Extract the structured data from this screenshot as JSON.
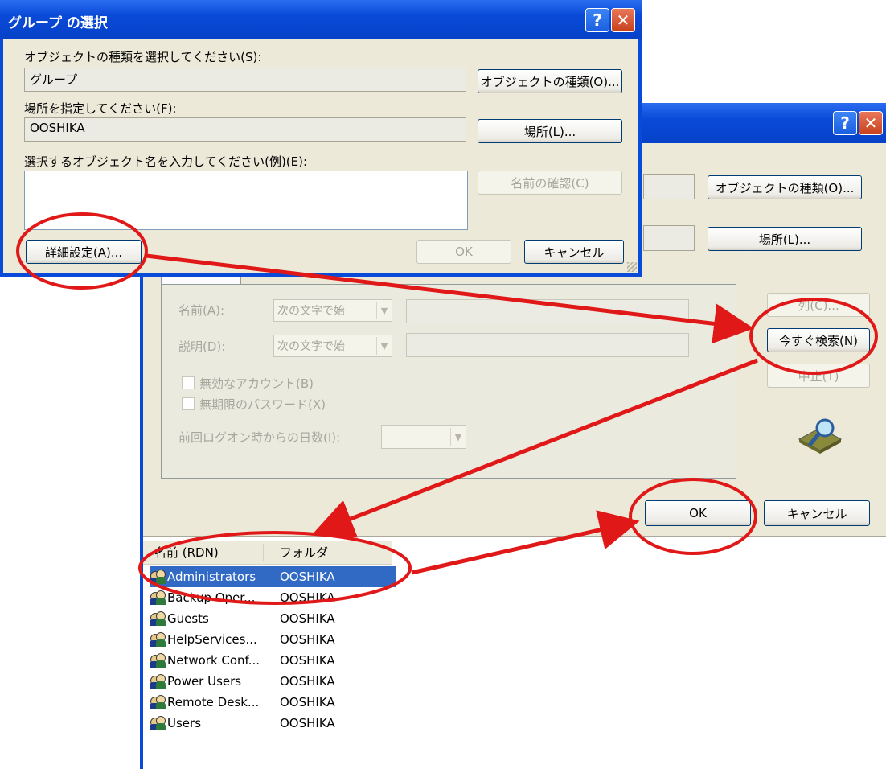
{
  "front_dialog": {
    "title": "グループ の選択",
    "help_glyph": "?",
    "close_glyph": "✕",
    "object_type_label": "オブジェクトの種類を選択してください(S):",
    "object_type_value": "グループ",
    "object_type_button": "オブジェクトの種類(O)...",
    "location_label": "場所を指定してください(F):",
    "location_value": "OOSHIKA",
    "location_button": "場所(L)...",
    "enter_names_label": "選択するオブジェクト名を入力してください(例)(E):",
    "check_names_button": "名前の確認(C)",
    "advanced_button": "詳細設定(A)...",
    "ok_button": "OK",
    "cancel_button": "キャンセル"
  },
  "back_dialog": {
    "help_glyph": "?",
    "close_glyph": "✕",
    "object_type_button": "オブジェクトの種類(O)...",
    "location_button": "場所(L)...",
    "columns_button": "列(C)...",
    "find_now_button": "今すぐ検索(N)",
    "stop_button": "中止(T)",
    "name_label": "名前(A):",
    "name_mode": "次の文字で始",
    "description_label": "説明(D):",
    "description_mode": "次の文字で始",
    "disabled_accounts": "無効なアカウント(B)",
    "non_expiring_pw": "無期限のパスワード(X)",
    "days_since_logon_label": "前回ログオン時からの日数(I):",
    "ok_button": "OK",
    "cancel_button": "キャンセル",
    "results": {
      "columns": [
        "名前 (RDN)",
        "フォルダ"
      ],
      "rows": [
        {
          "name": "Administrators",
          "folder": "OOSHIKA",
          "selected": true
        },
        {
          "name": "Backup Oper...",
          "folder": "OOSHIKA",
          "selected": false
        },
        {
          "name": "Guests",
          "folder": "OOSHIKA",
          "selected": false
        },
        {
          "name": "HelpServices...",
          "folder": "OOSHIKA",
          "selected": false
        },
        {
          "name": "Network Conf...",
          "folder": "OOSHIKA",
          "selected": false
        },
        {
          "name": "Power Users",
          "folder": "OOSHIKA",
          "selected": false
        },
        {
          "name": "Remote Desk...",
          "folder": "OOSHIKA",
          "selected": false
        },
        {
          "name": "Users",
          "folder": "OOSHIKA",
          "selected": false
        }
      ]
    }
  },
  "annotation_color": "#e01818"
}
